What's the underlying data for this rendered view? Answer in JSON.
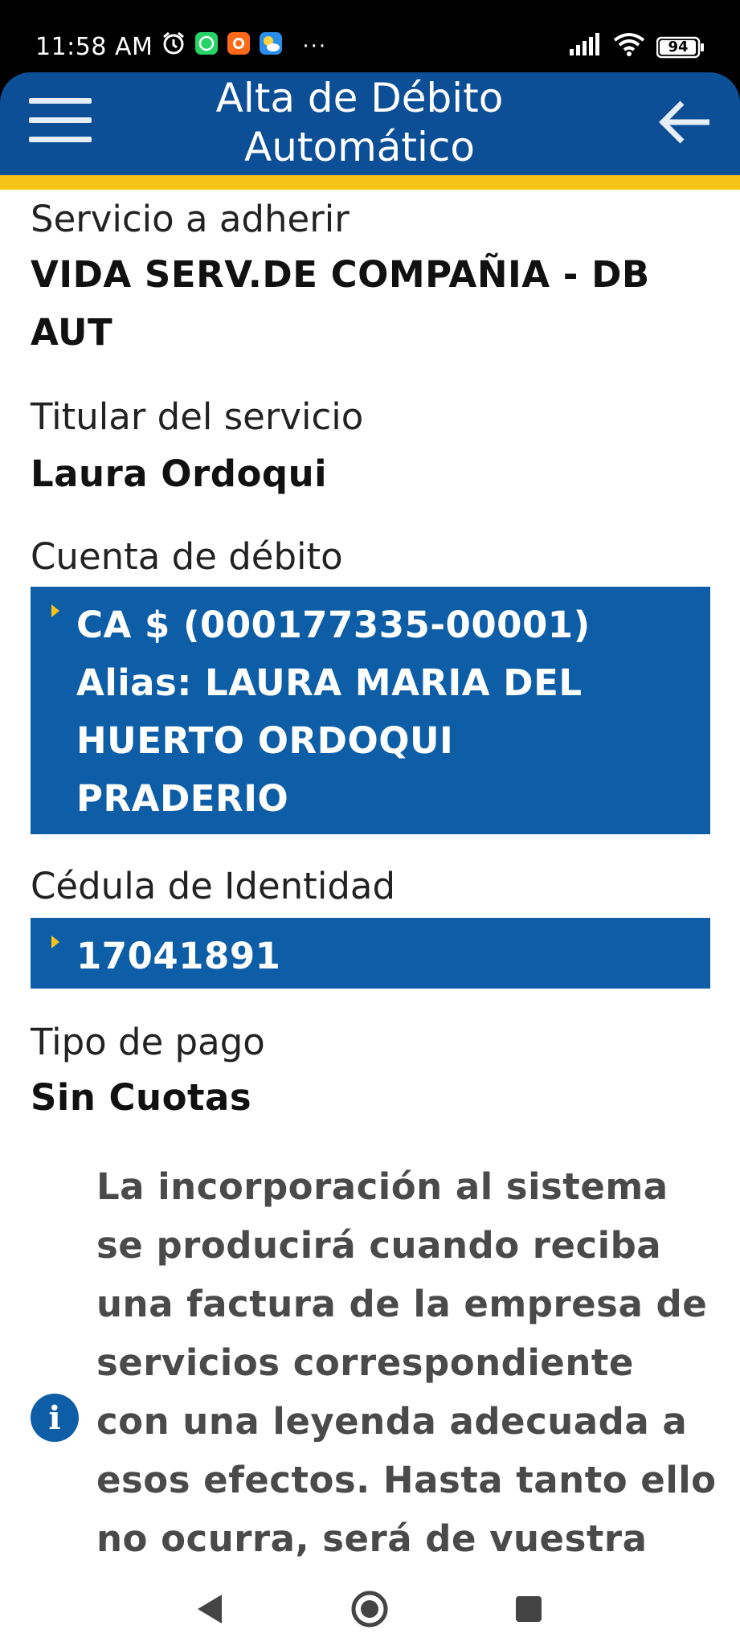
{
  "status_bar": {
    "time": "11:58 AM",
    "icons": [
      "alarm-icon",
      "whatsapp-icon",
      "app-icon",
      "weather-icon"
    ],
    "more": "···",
    "battery": "94"
  },
  "app_bar": {
    "title_line1": "Alta de Débito",
    "title_line2": "Automático",
    "menu_icon": "hamburger-menu-icon",
    "back_icon": "arrow-left-icon",
    "color": "#0d4f96",
    "accent": "#f6c417"
  },
  "form": {
    "service_label": "Servicio a adherir",
    "service_value_line1": "VIDA SERV.DE COMPAÑIA - DB",
    "service_value_line2": "AUT",
    "holder_label": "Titular del servicio",
    "holder_value": "Laura Ordoqui",
    "account_label": "Cuenta de débito",
    "account_lines": [
      "CA $ (000177335-00001)",
      "Alias: LAURA MARIA DEL",
      "HUERTO ORDOQUI",
      "PRADERIO"
    ],
    "id_label": "Cédula de Identidad",
    "id_value": "17041891",
    "payment_label": "Tipo de pago",
    "payment_value": "Sin Cuotas"
  },
  "info": {
    "icon": "info-icon",
    "lines": [
      "La incorporación al sistema",
      "se producirá cuando reciba",
      "una factura de la empresa de",
      "servicios correspondiente",
      "con una leyenda adecuada a",
      "esos efectos. Hasta tanto ello",
      "no ocurra, será de vuestra"
    ]
  },
  "nav_bar": {
    "back": "nav-back-icon",
    "home": "nav-home-icon",
    "recents": "nav-recents-icon"
  }
}
